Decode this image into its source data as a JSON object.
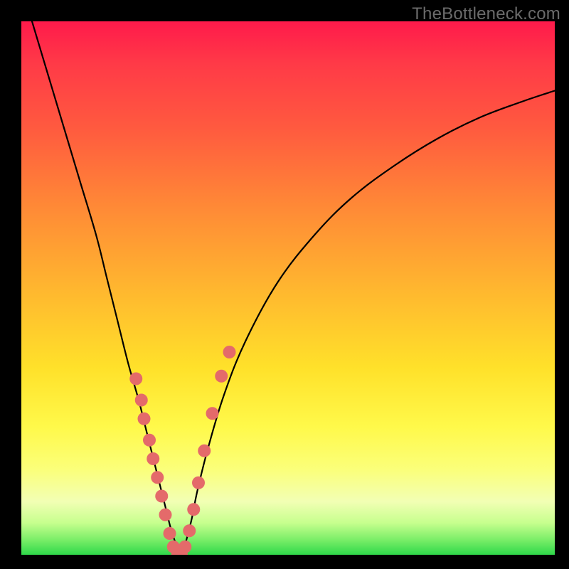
{
  "watermark": "TheBottleneck.com",
  "chart_data": {
    "type": "line",
    "title": "",
    "xlabel": "",
    "ylabel": "",
    "xlim": [
      0,
      100
    ],
    "ylim": [
      0,
      100
    ],
    "grid": false,
    "legend": false,
    "series": [
      {
        "name": "left-curve",
        "x": [
          2,
          5,
          8,
          11,
          14,
          16,
          18,
          20,
          22,
          23,
          24,
          25,
          26,
          27,
          28,
          29,
          30
        ],
        "values": [
          100,
          90,
          80,
          70,
          60,
          52,
          44,
          36,
          29,
          25,
          21,
          17,
          13,
          9,
          5,
          2,
          0
        ]
      },
      {
        "name": "right-curve",
        "x": [
          30,
          31,
          32,
          33,
          35,
          38,
          42,
          48,
          55,
          62,
          70,
          78,
          86,
          94,
          100
        ],
        "values": [
          0,
          3,
          7,
          12,
          20,
          30,
          40,
          51,
          60,
          67,
          73,
          78,
          82,
          85,
          87
        ]
      }
    ],
    "markers": {
      "name": "data-points",
      "x": [
        21.5,
        22.5,
        23.0,
        24.0,
        24.7,
        25.5,
        26.3,
        27.0,
        27.8,
        28.5,
        29.3,
        30.0,
        30.7,
        31.5,
        32.3,
        33.2,
        34.3,
        35.8,
        37.5,
        39.0
      ],
      "values": [
        33.0,
        29.0,
        25.5,
        21.5,
        18.0,
        14.5,
        11.0,
        7.5,
        4.0,
        1.5,
        0.0,
        0.0,
        1.5,
        4.5,
        8.5,
        13.5,
        19.5,
        26.5,
        33.5,
        38.0
      ],
      "color": "#e46a6a",
      "radius_ratio": 0.012
    },
    "background_gradient": {
      "direction": "vertical",
      "stops": [
        {
          "pos": 0.0,
          "color": "#ff1a4b"
        },
        {
          "pos": 0.35,
          "color": "#ff8a36"
        },
        {
          "pos": 0.65,
          "color": "#ffe12a"
        },
        {
          "pos": 0.9,
          "color": "#f2ffb4"
        },
        {
          "pos": 1.0,
          "color": "#2fd94a"
        }
      ]
    }
  }
}
